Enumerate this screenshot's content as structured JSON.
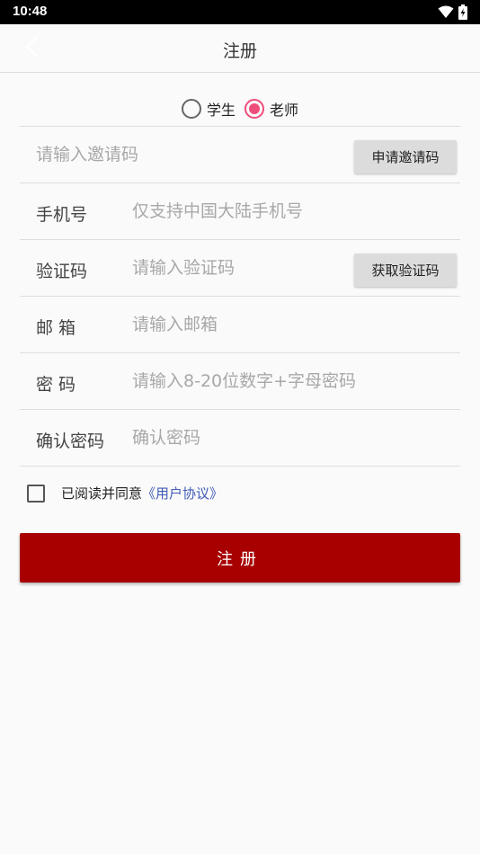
{
  "status_bar": {
    "time": "10:48",
    "icons": [
      "wifi-icon",
      "battery-icon"
    ]
  },
  "header": {
    "title": "注册",
    "back_icon": "chevron-left-icon"
  },
  "role": {
    "options": [
      {
        "label": "学生",
        "checked": false
      },
      {
        "label": "老师",
        "checked": true
      }
    ]
  },
  "form": {
    "invite": {
      "placeholder": "请输入邀请码",
      "value": "",
      "button": "申请邀请码"
    },
    "phone": {
      "label": "手机号",
      "placeholder": "仅支持中国大陆手机号",
      "value": ""
    },
    "code": {
      "label": "验证码",
      "placeholder": "请输入验证码",
      "value": "",
      "button": "获取验证码"
    },
    "email": {
      "label": "邮 箱",
      "placeholder": "请输入邮箱",
      "value": ""
    },
    "password": {
      "label": "密 码",
      "placeholder": "请输入8-20位数字+字母密码",
      "value": ""
    },
    "confirm": {
      "label": "确认密码",
      "placeholder": "确认密码",
      "value": ""
    }
  },
  "agreement": {
    "checked": false,
    "text": "已阅读并同意",
    "link": "《用户协议》"
  },
  "submit": {
    "label": "注册"
  },
  "colors": {
    "accent": "#ef4e7b",
    "primary_button": "#a80000",
    "link": "#3f5bb5"
  }
}
